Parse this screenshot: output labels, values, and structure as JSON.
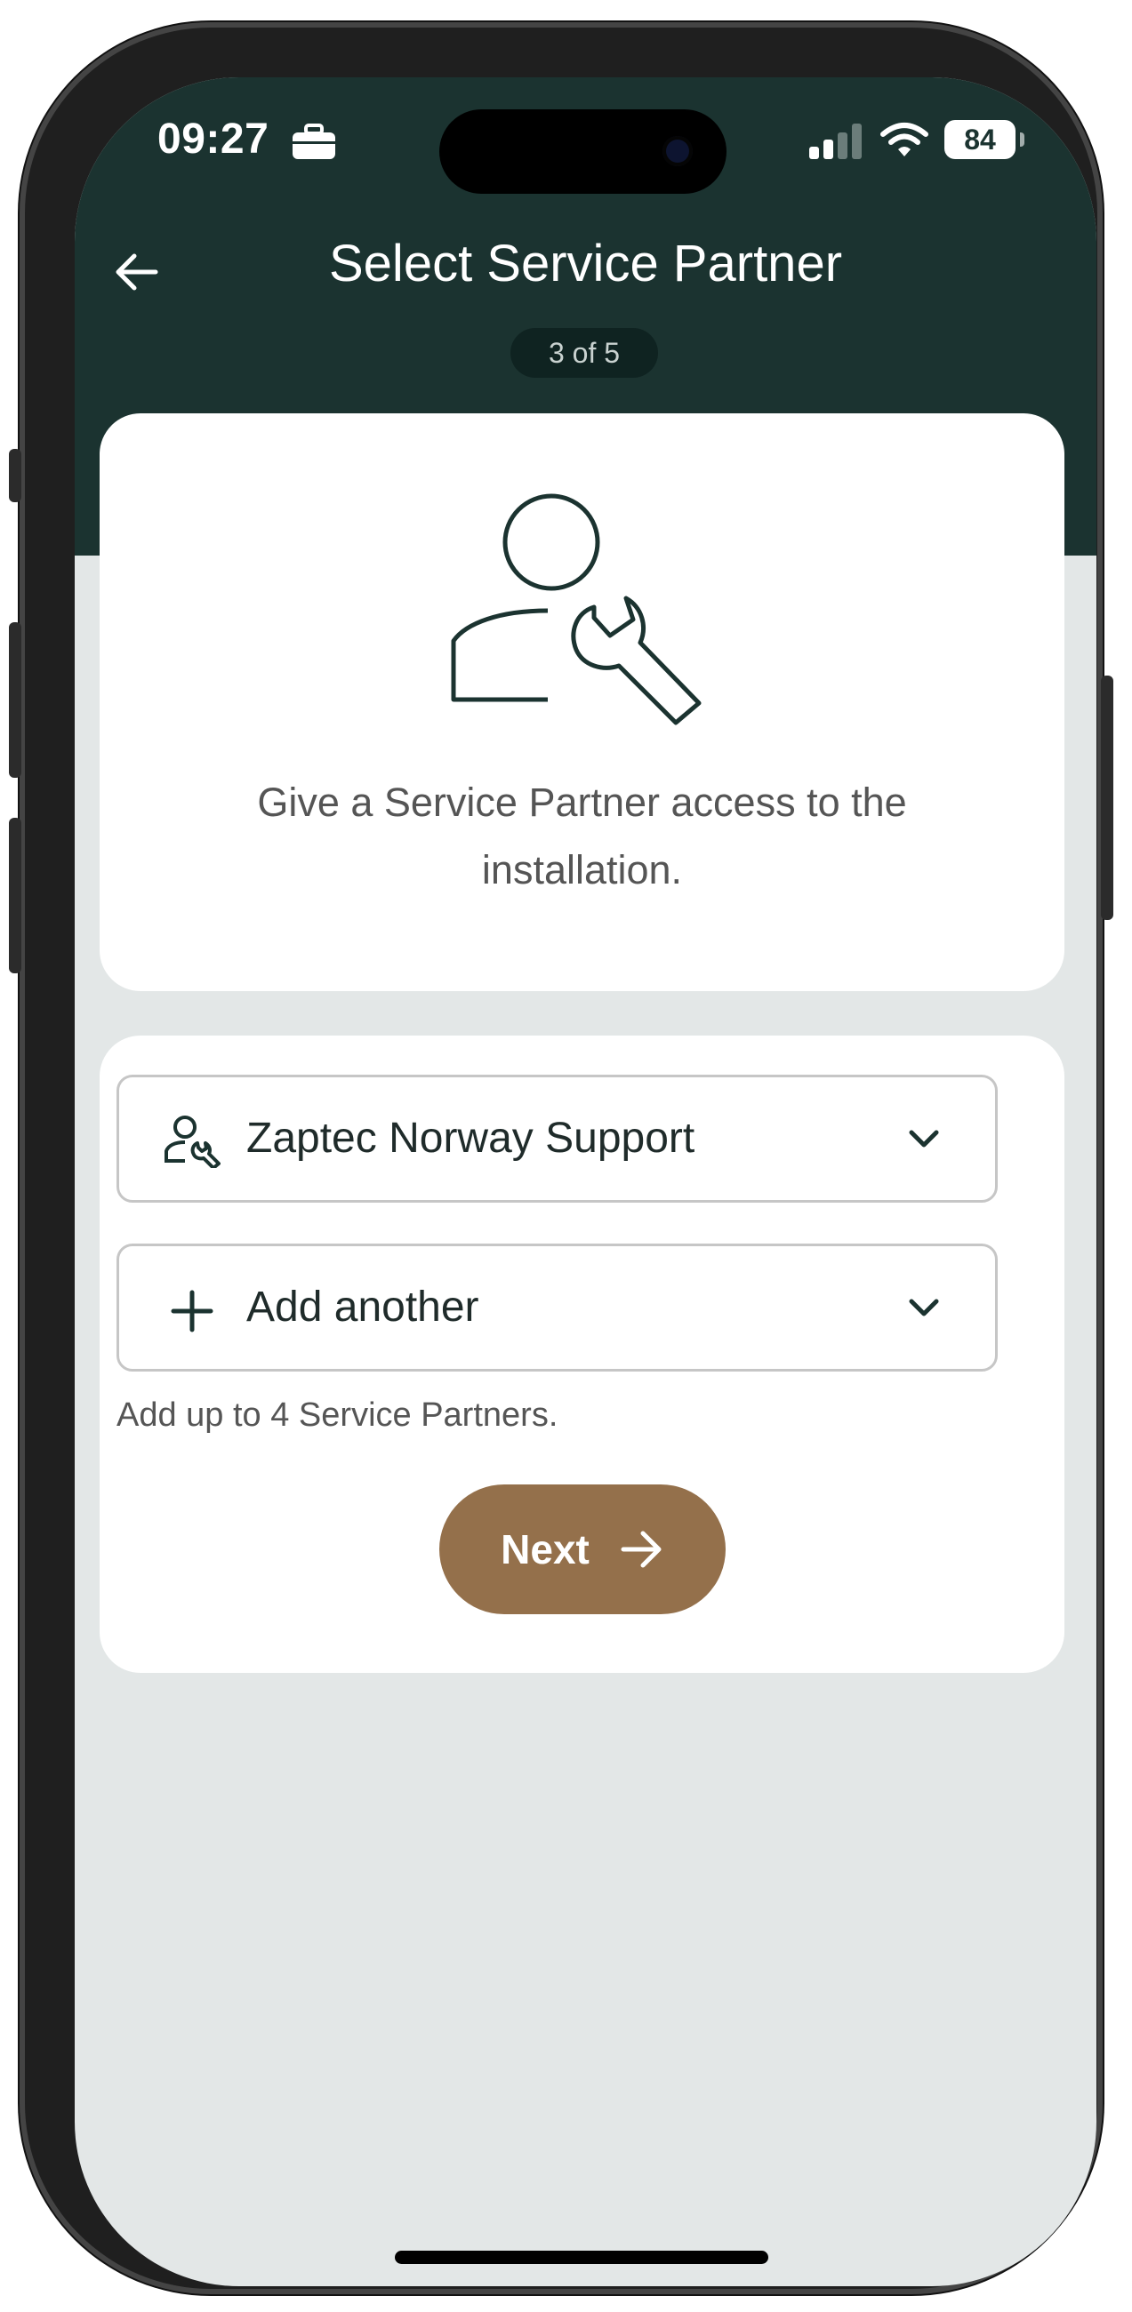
{
  "status_bar": {
    "time": "09:27",
    "battery": "84",
    "icons": [
      "briefcase-icon",
      "signal-icon",
      "wifi-icon",
      "battery-icon"
    ]
  },
  "header": {
    "title": "Select Service Partner",
    "step": "3 of 5",
    "back_icon": "arrow-left-icon"
  },
  "intro": {
    "text": "Give a Service Partner access to the installation.",
    "icon": "person-wrench-icon"
  },
  "form": {
    "selected_partner": "Zaptec Norway Support",
    "add_another": "Add another",
    "hint": "Add up to 4 Service Partners.",
    "next_label": "Next"
  },
  "colors": {
    "header_bg": "#1b3330",
    "page_bg": "#e3e7e7",
    "accent_button": "#94704b",
    "icon_dark": "#1b3330"
  }
}
